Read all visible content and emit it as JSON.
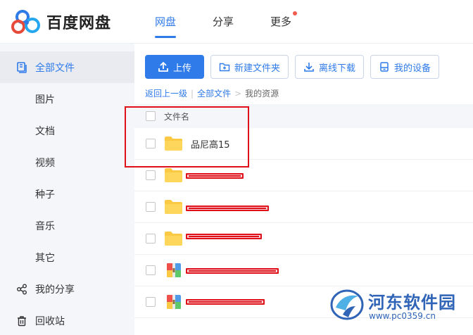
{
  "header": {
    "logo_text": "百度网盘",
    "nav": [
      {
        "label": "网盘",
        "active": true
      },
      {
        "label": "分享",
        "active": false
      },
      {
        "label": "更多",
        "active": false,
        "badge_dot": true
      }
    ]
  },
  "sidebar": {
    "items": [
      {
        "label": "全部文件",
        "icon": "files-icon",
        "active": true
      },
      {
        "label": "图片"
      },
      {
        "label": "文档"
      },
      {
        "label": "视频"
      },
      {
        "label": "种子"
      },
      {
        "label": "音乐"
      },
      {
        "label": "其它"
      },
      {
        "label": "我的分享",
        "icon": "share-icon"
      },
      {
        "label": "回收站",
        "icon": "trash-icon"
      }
    ]
  },
  "toolbar": {
    "upload_label": "上传",
    "new_folder_label": "新建文件夹",
    "offline_download_label": "离线下载",
    "my_devices_label": "我的设备"
  },
  "breadcrumb": {
    "back": "返回上一级",
    "all_files": "全部文件",
    "separator": ">",
    "current": "我的资源"
  },
  "file_list": {
    "column_header": "文件名",
    "rows": [
      {
        "name": "品尼高15",
        "type": "folder",
        "redacted": false
      },
      {
        "name": "",
        "type": "folder",
        "redacted": true
      },
      {
        "name": "",
        "type": "folder",
        "redacted": true
      },
      {
        "name": "",
        "type": "folder",
        "redacted": true
      },
      {
        "name": "",
        "type": "archive",
        "redacted": true
      },
      {
        "name": "",
        "type": "archive",
        "redacted": true
      }
    ]
  },
  "watermark": {
    "text": "河东软件园",
    "url": "www.pc0359.cn"
  },
  "colors": {
    "accent": "#2f7bea",
    "folder": "#fbc944",
    "annotation": "#e0101a",
    "sidebar_bg": "#f5f6fa"
  }
}
